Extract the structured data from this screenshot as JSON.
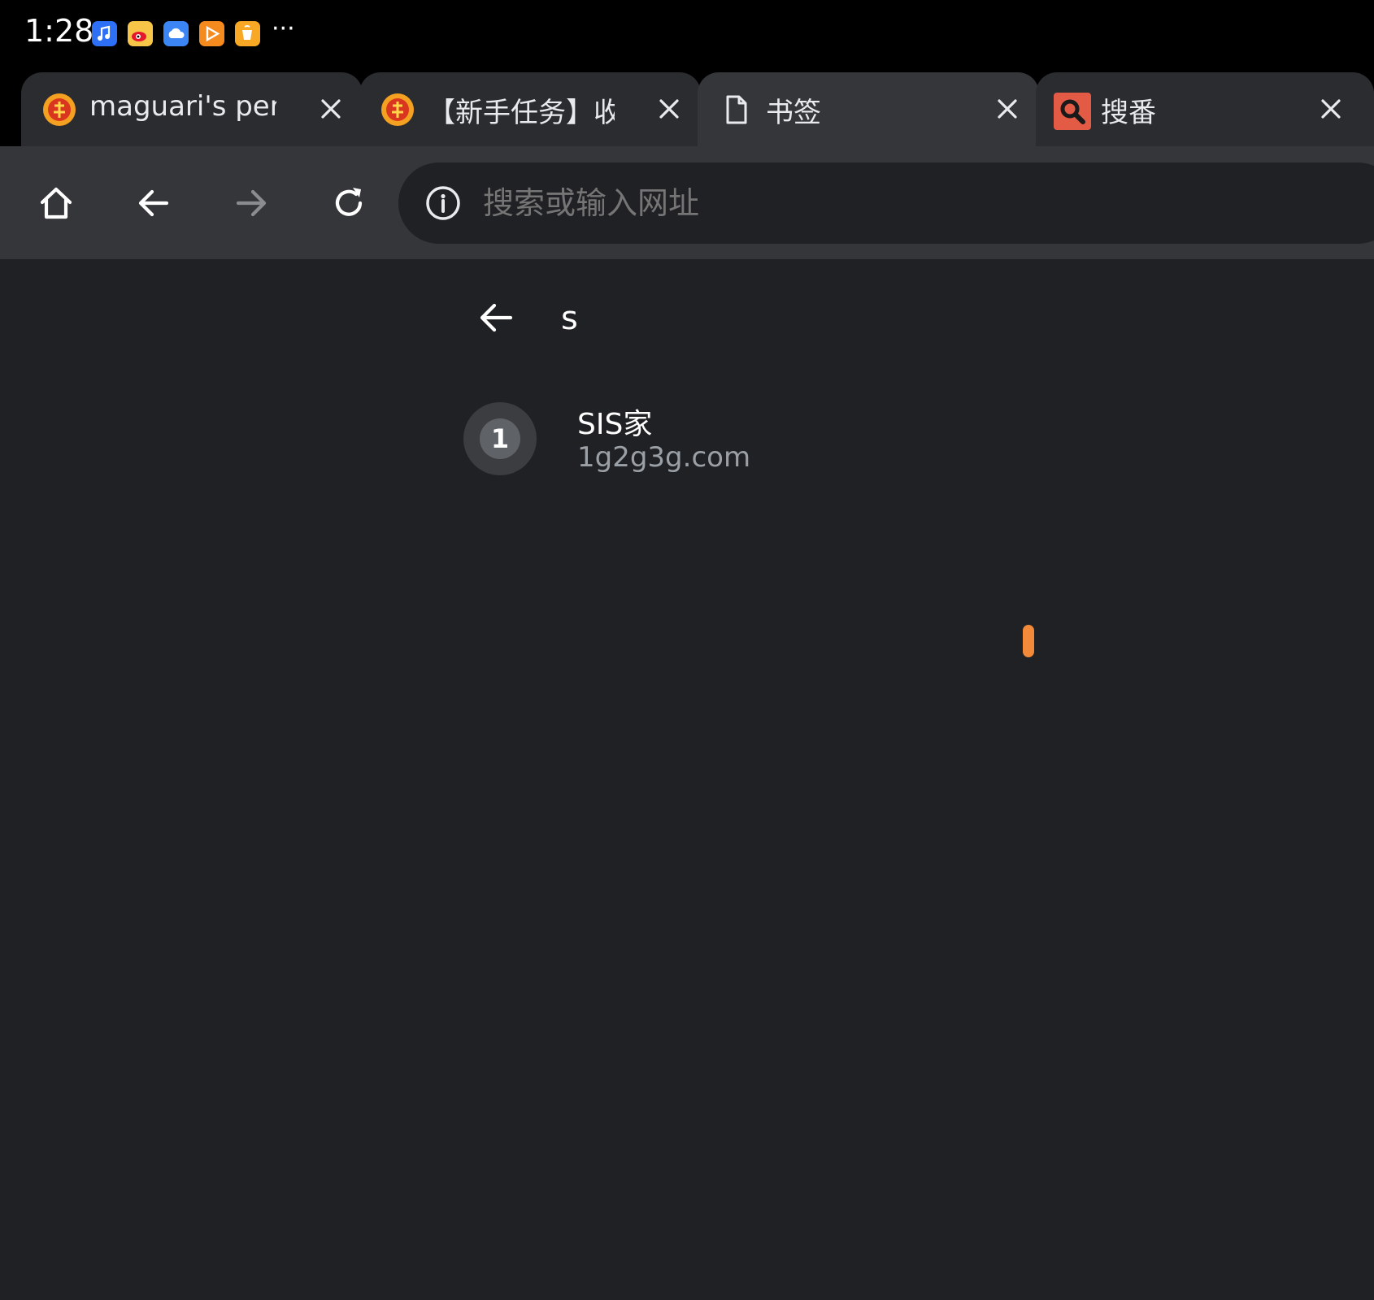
{
  "status_bar": {
    "time": "1:28",
    "icons": [
      "music-app-icon",
      "weibo-app-icon",
      "cloud-app-icon",
      "video-app-icon",
      "cup-app-icon"
    ],
    "more": "···"
  },
  "tabs": [
    {
      "title": "maguari's perso",
      "favicon": "site-logo-icon",
      "active": false
    },
    {
      "title": "【新手任务】收",
      "favicon": "site-logo-icon",
      "active": false
    },
    {
      "title": "书签",
      "favicon": "page-icon",
      "active": true
    },
    {
      "title": "搜番",
      "favicon": "search-logo-icon",
      "active": false
    }
  ],
  "toolbar": {
    "buttons": [
      "home-icon",
      "back-icon",
      "forward-icon",
      "reload-icon"
    ],
    "omnibox": {
      "placeholder": "搜索或输入网址",
      "icon": "info-icon"
    }
  },
  "bookmarks": {
    "folder_title": "s",
    "items": [
      {
        "avatar_letter": "1",
        "title": "SIS家",
        "url": "1g2g3g.com"
      }
    ]
  },
  "colors": {
    "status_bar_bg": "#000000",
    "tab_bg": "#2b2c30",
    "active_tab_bg": "#35363a",
    "toolbar_bg": "#35363a",
    "omnibox_bg": "#202124",
    "page_bg": "#202124",
    "touch_marker": "#f28a3a"
  }
}
